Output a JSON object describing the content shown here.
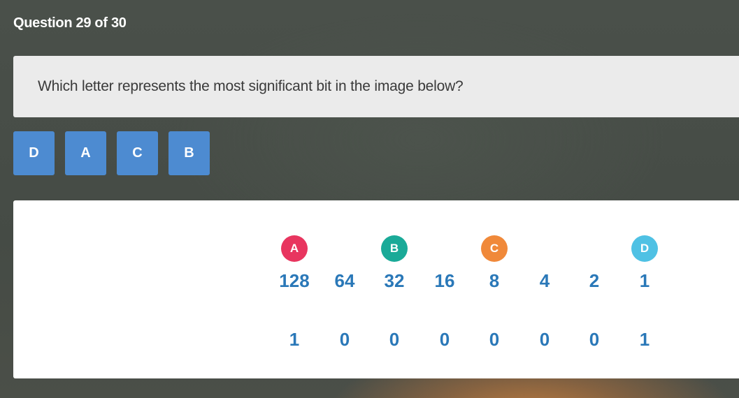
{
  "header": {
    "counter": "Question 29 of 30"
  },
  "question": {
    "text": "Which letter represents the most significant bit in the image below?"
  },
  "answers": [
    {
      "label": "D"
    },
    {
      "label": "A"
    },
    {
      "label": "C"
    },
    {
      "label": "B"
    }
  ],
  "figure": {
    "columns": [
      {
        "badge": "A",
        "badge_color": "#e8355f",
        "value": "128",
        "bit": "1"
      },
      {
        "badge": "",
        "badge_color": "",
        "value": "64",
        "bit": "0"
      },
      {
        "badge": "B",
        "badge_color": "#1aaa98",
        "value": "32",
        "bit": "0"
      },
      {
        "badge": "",
        "badge_color": "",
        "value": "16",
        "bit": "0"
      },
      {
        "badge": "C",
        "badge_color": "#f0893a",
        "value": "8",
        "bit": "0"
      },
      {
        "badge": "",
        "badge_color": "",
        "value": "4",
        "bit": "0"
      },
      {
        "badge": "",
        "badge_color": "",
        "value": "2",
        "bit": "0"
      },
      {
        "badge": "D",
        "badge_color": "#4fc1e4",
        "value": "1",
        "bit": "1"
      }
    ]
  },
  "colors": {
    "answer_button": "#4d8bd1",
    "value_text": "#2a78b8"
  }
}
